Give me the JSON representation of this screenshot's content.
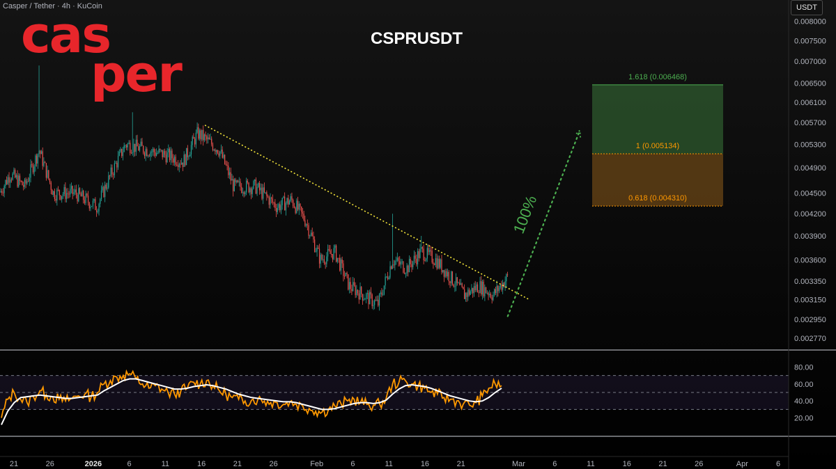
{
  "header": {
    "symbol_info": "Casper / Tether · 4h · KuCoin",
    "currency": "USDT",
    "title": "CSPRUSDT"
  },
  "logo": {
    "line1": "cas",
    "line2": "per"
  },
  "colors": {
    "up": "#26a69a",
    "down": "#ef5350",
    "trendline": "#f5e63a",
    "projection": "#4caf50",
    "rsi": "#ff9800",
    "rsi_ma": "#ffffff",
    "fib_green": "#4caf50",
    "fib_orange": "#ff9800"
  },
  "chart_data": [
    {
      "type": "candlestick",
      "title": "CSPRUSDT",
      "y_scale": "log",
      "y_ticks": [
        "0.008000",
        "0.007500",
        "0.007000",
        "0.006500",
        "0.006100",
        "0.005700",
        "0.005300",
        "0.004900",
        "0.004500",
        "0.004200",
        "0.003900",
        "0.003600",
        "0.003350",
        "0.003150",
        "0.002950",
        "0.002770"
      ],
      "y_tick_values": [
        0.008,
        0.0075,
        0.007,
        0.0065,
        0.0061,
        0.0057,
        0.0053,
        0.0049,
        0.0045,
        0.0042,
        0.0039,
        0.0036,
        0.00335,
        0.00315,
        0.00295,
        0.00277
      ],
      "x_ticks": [
        "21",
        "26",
        "2026",
        "6",
        "11",
        "16",
        "21",
        "26",
        "Feb",
        "6",
        "11",
        "16",
        "21",
        "Mar",
        "6",
        "11",
        "16",
        "21",
        "26",
        "Apr",
        "6"
      ],
      "price_path": [
        {
          "x": "Dec 18",
          "y": 0.0044
        },
        {
          "x": "Dec 20",
          "y": 0.0048
        },
        {
          "x": "Dec 22",
          "y": 0.0046
        },
        {
          "x": "Dec 24",
          "y": 0.0052
        },
        {
          "x": "Dec 26",
          "y": 0.0045
        },
        {
          "x": "Dec 29",
          "y": 0.0045
        },
        {
          "x": "Jan 1",
          "y": 0.0043
        },
        {
          "x": "Jan 3",
          "y": 0.0048
        },
        {
          "x": "Jan 5",
          "y": 0.0053
        },
        {
          "x": "Jan 8",
          "y": 0.0052
        },
        {
          "x": "Jan 11",
          "y": 0.0051
        },
        {
          "x": "Jan 13",
          "y": 0.005
        },
        {
          "x": "Jan 15",
          "y": 0.0055
        },
        {
          "x": "Jan 18",
          "y": 0.0052
        },
        {
          "x": "Jan 20",
          "y": 0.0046
        },
        {
          "x": "Jan 23",
          "y": 0.0046
        },
        {
          "x": "Jan 26",
          "y": 0.0043
        },
        {
          "x": "Jan 28",
          "y": 0.0044
        },
        {
          "x": "Jan 30",
          "y": 0.0041
        },
        {
          "x": "Feb 1",
          "y": 0.0036
        },
        {
          "x": "Feb 3",
          "y": 0.0037
        },
        {
          "x": "Feb 5",
          "y": 0.0033
        },
        {
          "x": "Feb 7",
          "y": 0.0032
        },
        {
          "x": "Feb 9",
          "y": 0.0031
        },
        {
          "x": "Feb 11",
          "y": 0.0036
        },
        {
          "x": "Feb 13",
          "y": 0.0035
        },
        {
          "x": "Feb 15",
          "y": 0.0037
        },
        {
          "x": "Feb 17",
          "y": 0.0036
        },
        {
          "x": "Feb 19",
          "y": 0.0034
        },
        {
          "x": "Feb 21",
          "y": 0.0032
        },
        {
          "x": "Feb 23",
          "y": 0.0033
        },
        {
          "x": "Feb 25",
          "y": 0.0032
        },
        {
          "x": "Feb 27",
          "y": 0.0034
        }
      ],
      "spikes": [
        {
          "x": "Dec 24",
          "high": 0.0069
        },
        {
          "x": "Jan 6",
          "high": 0.0059
        },
        {
          "x": "Feb 11",
          "high": 0.0042
        },
        {
          "x": "Feb 15",
          "high": 0.0039
        }
      ],
      "trendline": {
        "from": {
          "x": "Jan 16",
          "y": 0.00565
        },
        "to": {
          "x": "Mar 2",
          "y": 0.00315
        }
      },
      "projection": {
        "from": {
          "x": "Feb 27",
          "y": 0.00298
        },
        "to": {
          "x": "Mar 9",
          "y": 0.00555
        },
        "label": "100%"
      },
      "fib_levels": [
        {
          "label": "1.618 (0.006468)",
          "value": 0.006468
        },
        {
          "label": "1 (0.005134)",
          "value": 0.005134
        },
        {
          "label": "0.618 (0.004310)",
          "value": 0.00431
        }
      ]
    },
    {
      "type": "line",
      "title": "",
      "y_ticks": [
        "80.00",
        "60.00",
        "40.00",
        "20.00"
      ],
      "y_tick_values": [
        80,
        60,
        40,
        20
      ],
      "ylim": [
        0,
        100
      ],
      "bands": [
        70,
        50,
        30
      ],
      "rsi": [
        20,
        42,
        50,
        42,
        38,
        45,
        52,
        47,
        45,
        42,
        40,
        43,
        46,
        48,
        45,
        50,
        60,
        64,
        68,
        70,
        72,
        66,
        60,
        55,
        58,
        54,
        50,
        48,
        52,
        55,
        62,
        60,
        64,
        58,
        52,
        48,
        44,
        42,
        40,
        41,
        42,
        40,
        38,
        38,
        36,
        39,
        36,
        34,
        31,
        28,
        27,
        30,
        34,
        36,
        40,
        42,
        38,
        36,
        35,
        36,
        43,
        60,
        62,
        64,
        60,
        58,
        55,
        50,
        48,
        44,
        42,
        40,
        36,
        35,
        38,
        46,
        55,
        60,
        58
      ],
      "ma": [
        12,
        28,
        38,
        44,
        45,
        46,
        47,
        46,
        45,
        44,
        43,
        43,
        44,
        45,
        46,
        47,
        52,
        56,
        60,
        64,
        66,
        66,
        64,
        62,
        60,
        58,
        56,
        54,
        54,
        55,
        57,
        58,
        59,
        58,
        56,
        54,
        51,
        48,
        46,
        44,
        43,
        42,
        41,
        40,
        39,
        39,
        38,
        36,
        34,
        32,
        30,
        30,
        31,
        33,
        35,
        37,
        38,
        38,
        37,
        38,
        41,
        48,
        54,
        58,
        59,
        58,
        57,
        55,
        52,
        49,
        46,
        44,
        42,
        40,
        39,
        40,
        44,
        50,
        55
      ]
    }
  ]
}
